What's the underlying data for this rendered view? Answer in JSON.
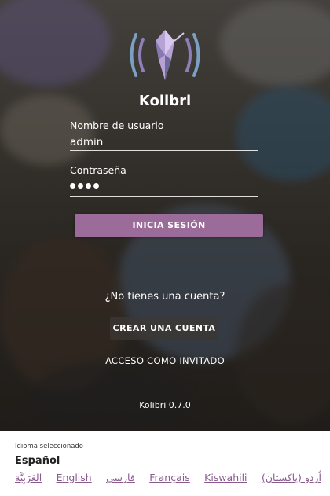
{
  "app": {
    "name": "Kolibri",
    "version": "Kolibri 0.7.0"
  },
  "login": {
    "username_label": "Nombre de usuario",
    "username_value": "admin",
    "password_label": "Contraseña",
    "password_masked_length": 4,
    "submit_label": "INICIA SESIÓN"
  },
  "signup": {
    "prompt": "¿No tienes una cuenta?",
    "create_label": "CREAR UNA CUENTA"
  },
  "guest": {
    "label": "ACCESO COMO INVITADO"
  },
  "language": {
    "caption": "Idioma seleccionado",
    "selected": "Español",
    "options": [
      "العَرَبِيَّة",
      "English",
      "فارسی",
      "Français",
      "Kiswahili",
      "اُردو (پاکستان)"
    ]
  },
  "colors": {
    "accent": "#9b6b9a",
    "link": "#8a5a8e",
    "panel_bg": "#ffffff"
  },
  "icons": {
    "logo": "kolibri-hummingbird-logo"
  }
}
